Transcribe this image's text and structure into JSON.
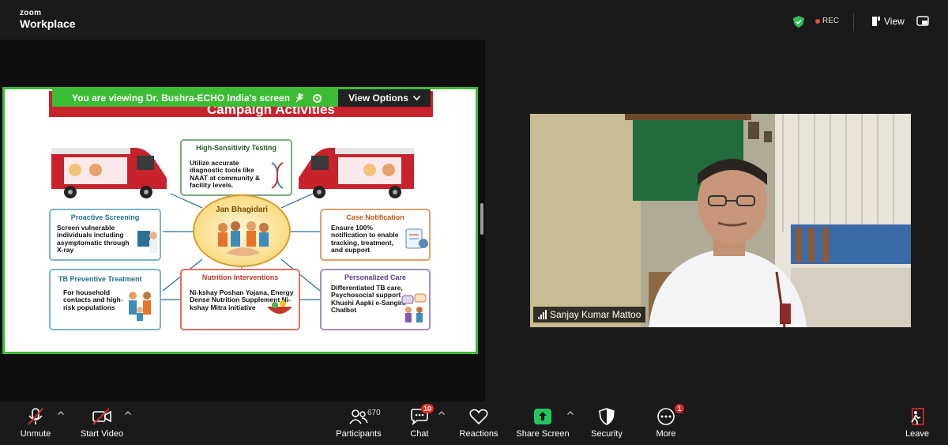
{
  "app": {
    "brand_line1": "zoom",
    "brand_line2": "Workplace"
  },
  "header": {
    "rec_label": "REC",
    "view_label": "View"
  },
  "share_banner": {
    "viewing_text": "You are viewing  Dr. Bushra-ECHO India's screen",
    "view_options_label": "View Options"
  },
  "slide": {
    "banner_title": "Campaign Activities",
    "center_title": "Jan Bhagidari",
    "cards": {
      "high_sensitivity": {
        "title": "High-Sensitivity Testing",
        "body": "Utilize accurate diagnostic tools like NAAT at community & facility levels."
      },
      "proactive": {
        "title": "Proactive Screening",
        "body": "Screen vulnerable individuals including asymptomatic through X-ray"
      },
      "case_notification": {
        "title": "Case Notification",
        "body": "Ensure 100% notification to enable tracking, treatment, and support"
      },
      "tb_preventive": {
        "title": "TB Preventive Treatment",
        "body": "For household contacts and high-risk populations"
      },
      "nutrition": {
        "title": "Nutrition Interventions",
        "body": "Ni-kshay Poshan Yojana, Energy Dense Nutrition Supplement Ni-kshay Mitra initiative"
      },
      "personalized": {
        "title": "Personalized Care",
        "body": "Differentiated TB care, Psychosocial support Khushi Aapki e-Sangini Chatbot"
      }
    }
  },
  "participant": {
    "name": "Sanjay Kumar Mattoo"
  },
  "toolbar": {
    "unmute": "Unmute",
    "start_video": "Start Video",
    "participants": "Participants",
    "participants_count": "670",
    "chat": "Chat",
    "chat_badge": "10",
    "reactions": "Reactions",
    "share_screen": "Share Screen",
    "security": "Security",
    "more": "More",
    "more_badge": "1",
    "leave": "Leave"
  },
  "colors": {
    "accent_green": "#3cbc34",
    "badge_red": "#e02929",
    "banner_red": "#c8232c"
  }
}
